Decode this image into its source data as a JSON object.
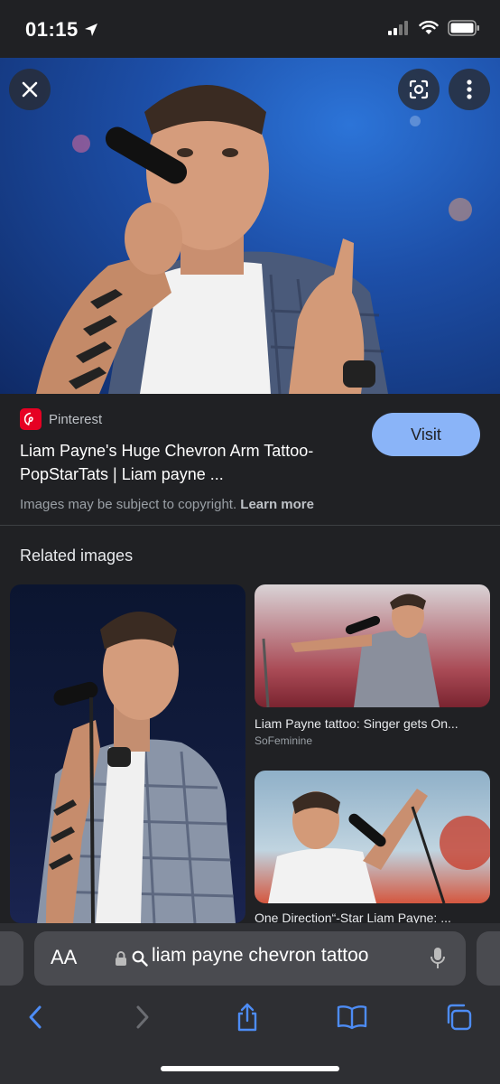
{
  "status": {
    "time": "01:15"
  },
  "hero": {
    "close_icon": "close-icon",
    "lens_icon": "lens-icon",
    "more_icon": "more-vert-icon"
  },
  "result": {
    "source": "Pinterest",
    "title": "Liam Payne's Huge Chevron Arm Tattoo- PopStarTats | Liam payne ...",
    "visit_label": "Visit",
    "copyright_text": "Images may be subject to copyright.",
    "learn_more": "Learn more"
  },
  "related": {
    "heading": "Related images",
    "items": [
      {
        "caption": "Liam Payne tattoo: Singer gets On...",
        "source": "SoFeminine"
      },
      {
        "caption": "One Direction“-Star Liam Payne: ...",
        "source": ""
      }
    ]
  },
  "browser": {
    "aa_label": "AA",
    "url": "liam payne chevron tattoo"
  },
  "colors": {
    "accent": "#8ab4f8",
    "background": "#202124",
    "pinterest": "#e60023"
  }
}
